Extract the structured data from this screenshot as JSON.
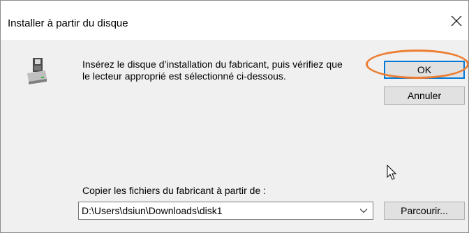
{
  "window": {
    "title": "Installer à partir du disque",
    "close_icon": "close-icon"
  },
  "message": {
    "line1": "Insérez le disque d’installation du fabricant, puis vérifiez que",
    "line2": "le lecteur approprié est sélectionné ci-dessous."
  },
  "buttons": {
    "ok": "OK",
    "cancel": "Annuler",
    "browse": "Parcourir..."
  },
  "copy_from": {
    "label": "Copier les fichiers du fabricant à partir de :",
    "value": "D:\\Users\\dsiun\\Downloads\\disk1"
  },
  "icons": {
    "disk": "floppy-disk-drive-icon",
    "dropdown": "chevron-down-icon",
    "cursor": "mouse-pointer-icon"
  },
  "colors": {
    "highlight": "#ed7d31",
    "focus_border": "#0078d7"
  }
}
